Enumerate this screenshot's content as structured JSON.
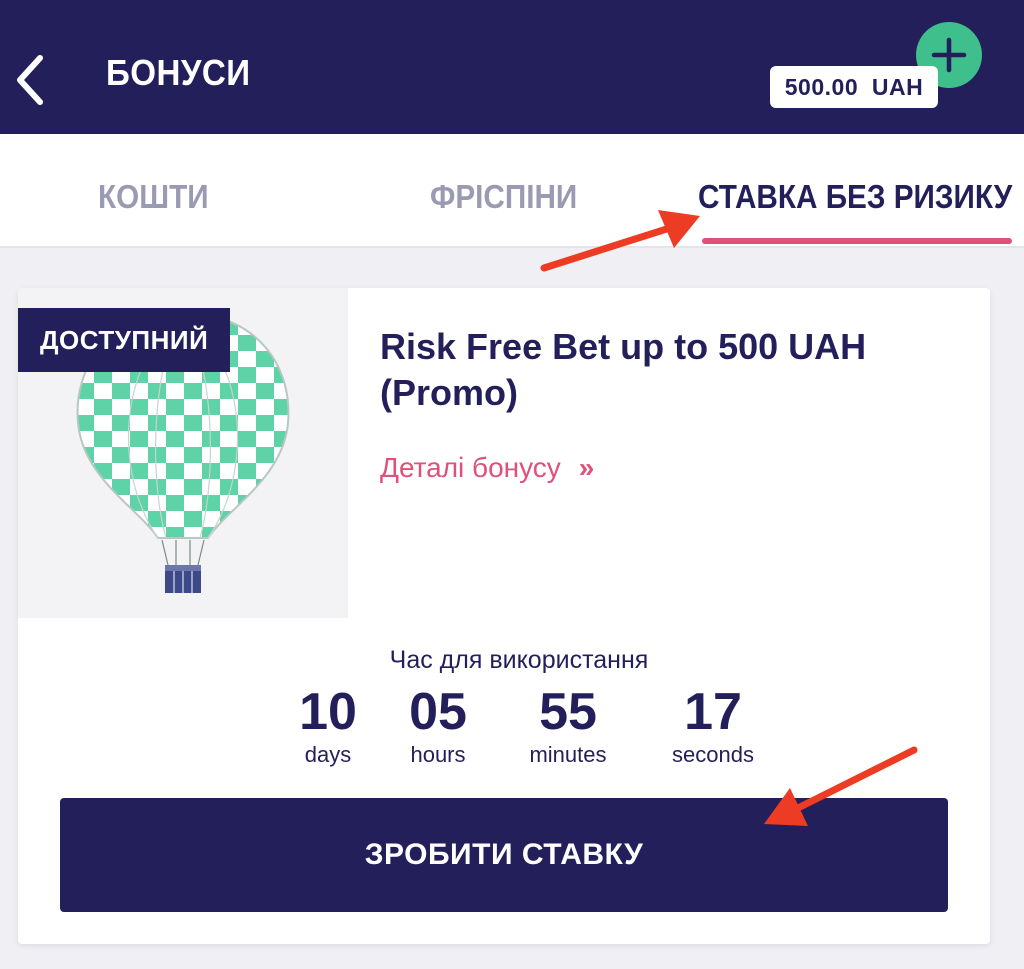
{
  "header": {
    "title": "БОНУСИ",
    "balance": "500.00  UAH"
  },
  "tabs": [
    {
      "label": "КОШТИ",
      "active": false
    },
    {
      "label": "ФРІСПІНИ",
      "active": false
    },
    {
      "label": "СТАВКА БЕЗ РИЗИКУ",
      "active": true
    }
  ],
  "bonus": {
    "status": "ДОСТУПНИЙ",
    "title": "Risk Free Bet up to 500 UAH (Promo)",
    "details_link": "Деталі бонусу",
    "timer_label": "Час для використання",
    "timer": [
      {
        "value": "10",
        "unit": "days"
      },
      {
        "value": "05",
        "unit": "hours"
      },
      {
        "value": "55",
        "unit": "minutes"
      },
      {
        "value": "17",
        "unit": "seconds"
      }
    ],
    "cta": "ЗРОБИТИ СТАВКУ"
  },
  "colors": {
    "header_bg": "#231f5a",
    "accent_pink": "#e0507a",
    "add_button": "#3fbf8c",
    "balloon_green": "#5fd3a8",
    "annotation_red": "#ee3b24"
  },
  "icons": {
    "back": "chevron-left-icon",
    "add": "plus-icon",
    "details": "double-chevron-right-icon",
    "image": "hot-air-balloon-icon"
  }
}
